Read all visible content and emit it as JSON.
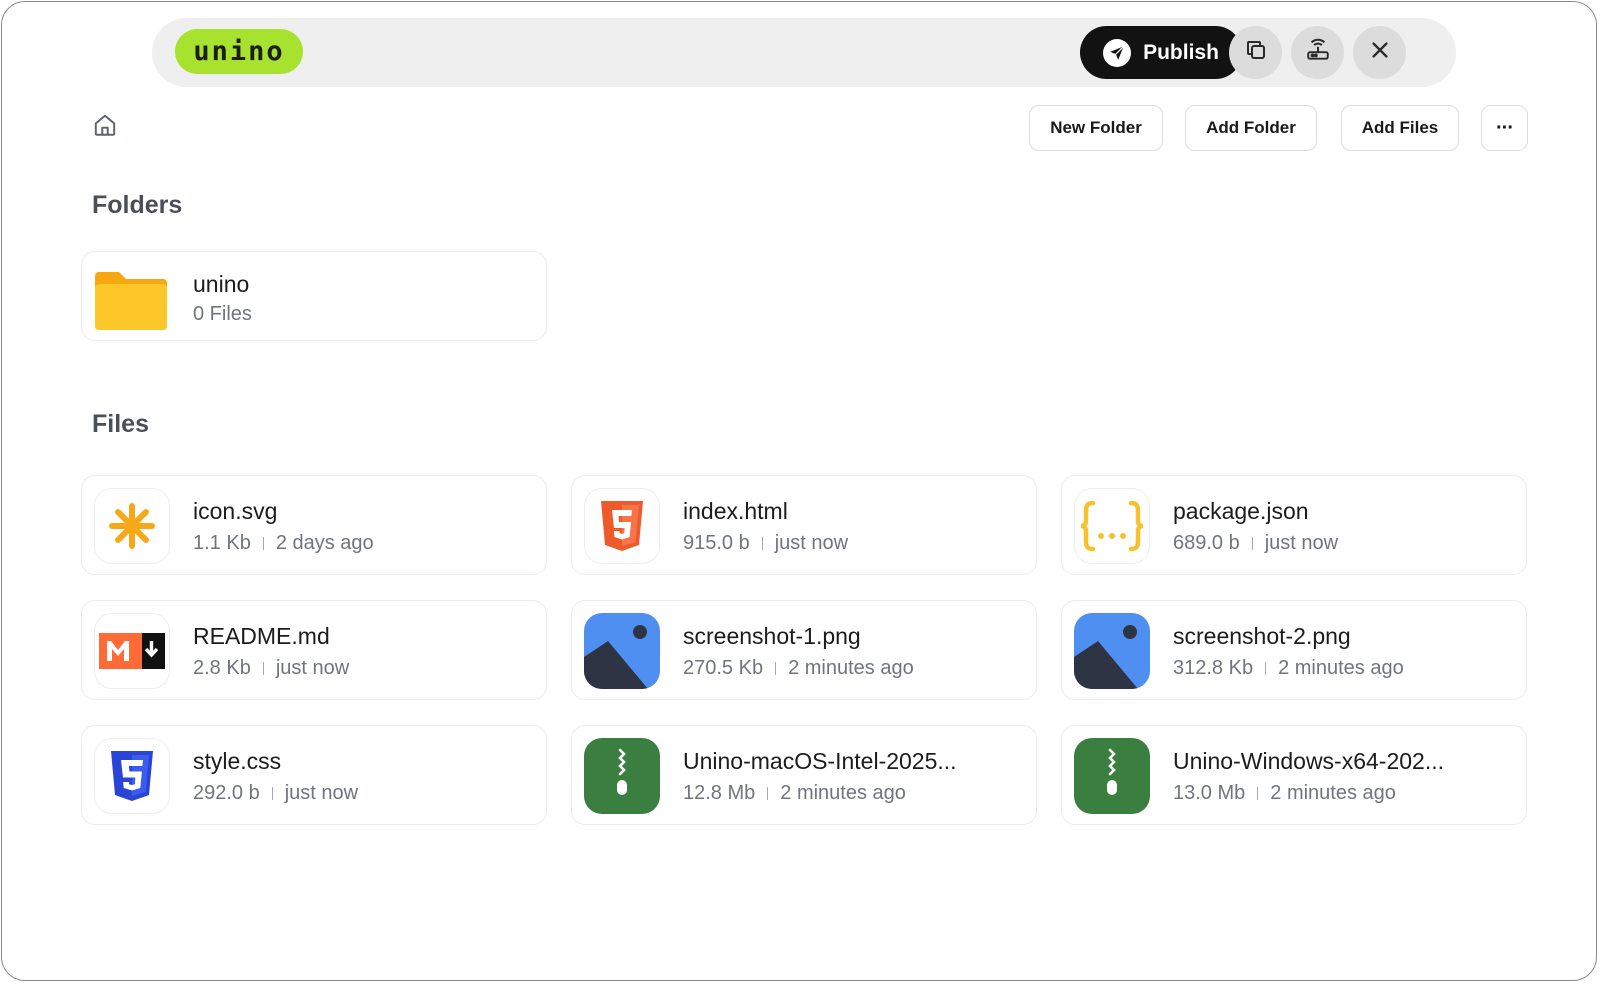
{
  "app": {
    "logo_text": "unino"
  },
  "topbar": {
    "publish_label": "Publish",
    "icons": [
      "paper-plane-icon",
      "copy-icon",
      "router-icon",
      "close-icon"
    ]
  },
  "toolbar": {
    "new_folder": "New Folder",
    "add_folder": "Add Folder",
    "add_files": "Add Files",
    "more": "···"
  },
  "sections": {
    "folders": "Folders",
    "files": "Files"
  },
  "folders": [
    {
      "name": "unino",
      "meta": "0 Files",
      "icon": "folder-icon"
    }
  ],
  "files": [
    {
      "name": "icon.svg",
      "size": "1.1 Kb",
      "time": "2 days ago",
      "icon": "svg-file-icon"
    },
    {
      "name": "index.html",
      "size": "915.0 b",
      "time": "just now",
      "icon": "html5-file-icon"
    },
    {
      "name": "package.json",
      "size": "689.0 b",
      "time": "just now",
      "icon": "json-file-icon"
    },
    {
      "name": "README.md",
      "size": "2.8 Kb",
      "time": "just now",
      "icon": "markdown-file-icon"
    },
    {
      "name": "screenshot-1.png",
      "size": "270.5 Kb",
      "time": "2 minutes ago",
      "icon": "image-file-icon"
    },
    {
      "name": "screenshot-2.png",
      "size": "312.8 Kb",
      "time": "2 minutes ago",
      "icon": "image-file-icon"
    },
    {
      "name": "style.css",
      "size": "292.0 b",
      "time": "just now",
      "icon": "css3-file-icon"
    },
    {
      "name": "Unino-macOS-Intel-2025...",
      "size": "12.8 Mb",
      "time": "2 minutes ago",
      "icon": "zip-file-icon"
    },
    {
      "name": "Unino-Windows-x64-202...",
      "size": "13.0 Mb",
      "time": "2 minutes ago",
      "icon": "zip-file-icon"
    }
  ],
  "colors": {
    "logo_bg": "#a7e22e",
    "publish_bg": "#121212",
    "folder": "#fdc72a",
    "svg_star": "#f7a818",
    "html5": "#ef5a2b",
    "json_braces": "#f5c12f",
    "markdown": "#ff6a37",
    "image_sky": "#4f8ff2",
    "image_mountain": "#2f3444",
    "css3": "#2a45d6",
    "zip": "#3a7f3f"
  }
}
